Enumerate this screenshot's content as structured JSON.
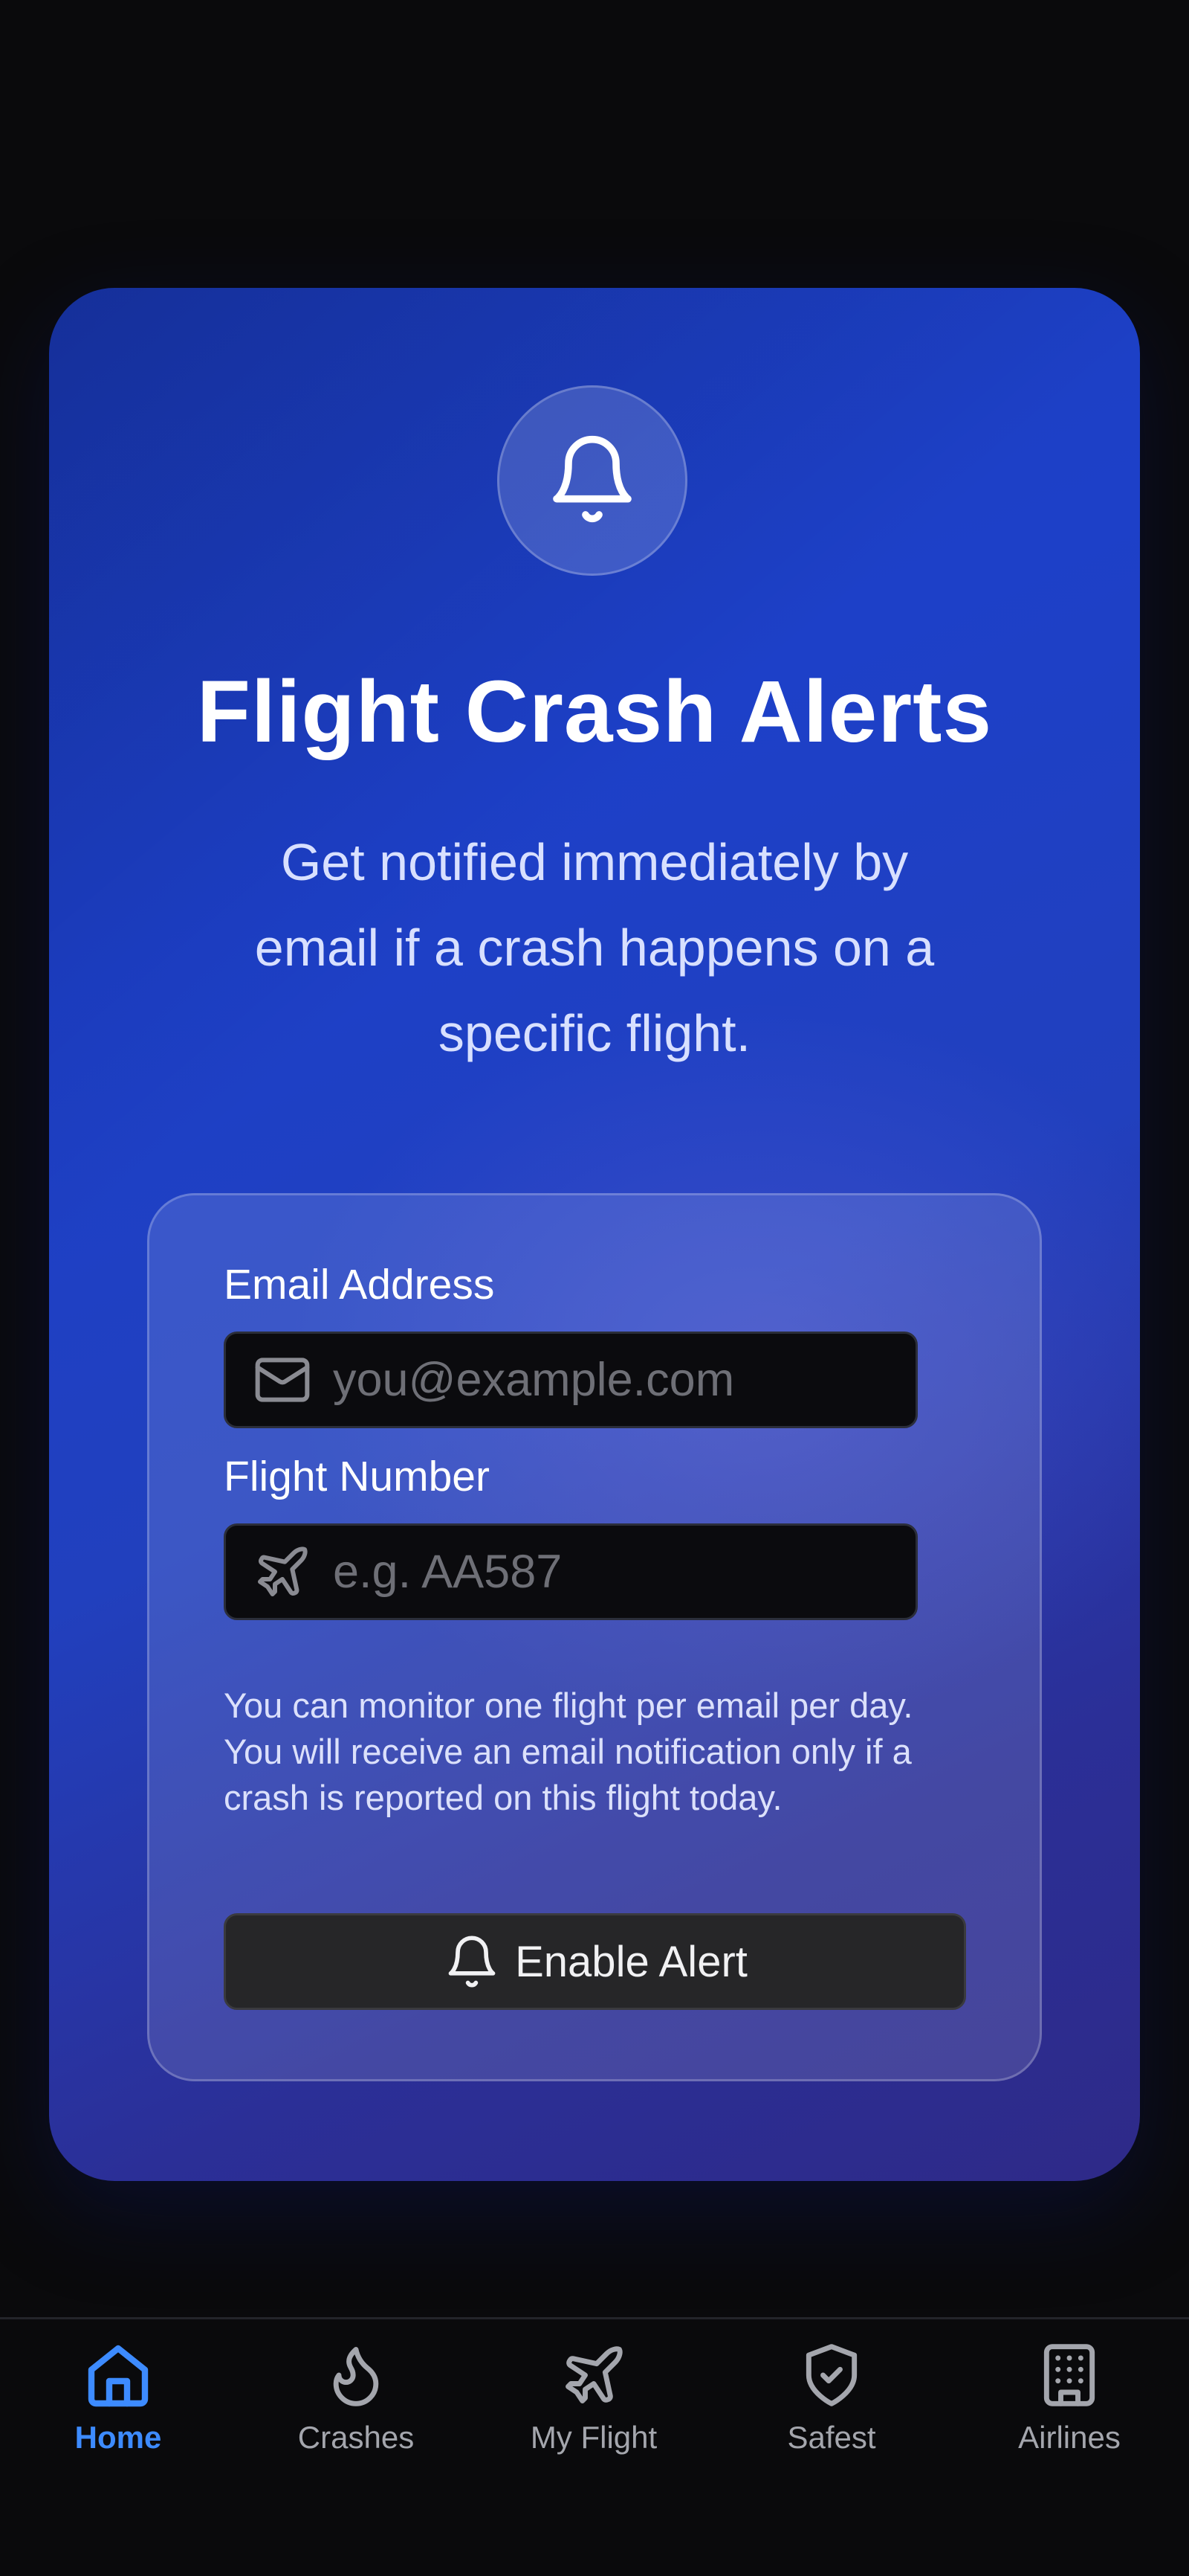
{
  "alert_card": {
    "icon": "bell-icon",
    "title": "Flight Crash Alerts",
    "subtitle": "Get notified immediately by email if a crash happens on a specific flight."
  },
  "form": {
    "email": {
      "label": "Email Address",
      "placeholder": "you@example.com",
      "value": "",
      "icon": "mail-icon"
    },
    "flight": {
      "label": "Flight Number",
      "placeholder": "e.g. AA587",
      "value": "",
      "icon": "airplane-icon"
    },
    "help_text": "You can monitor one flight per email per day. You will receive an email notification only if a crash is reported on this flight today.",
    "submit": {
      "label": "Enable Alert",
      "icon": "bell-icon"
    }
  },
  "bottom_nav": {
    "items": [
      {
        "label": "Home",
        "icon": "home-icon",
        "active": true
      },
      {
        "label": "Crashes",
        "icon": "flame-icon",
        "active": false
      },
      {
        "label": "My Flight",
        "icon": "airplane-icon",
        "active": false
      },
      {
        "label": "Safest",
        "icon": "shield-check-icon",
        "active": false
      },
      {
        "label": "Airlines",
        "icon": "building-icon",
        "active": false
      }
    ]
  },
  "colors": {
    "background": "#0a0a0c",
    "card_gradient_start": "#1d40c8",
    "card_gradient_end": "#2e2a88",
    "active_nav": "#3d8bff",
    "inactive_nav": "#a4a6ad",
    "button_background": "#262628"
  }
}
